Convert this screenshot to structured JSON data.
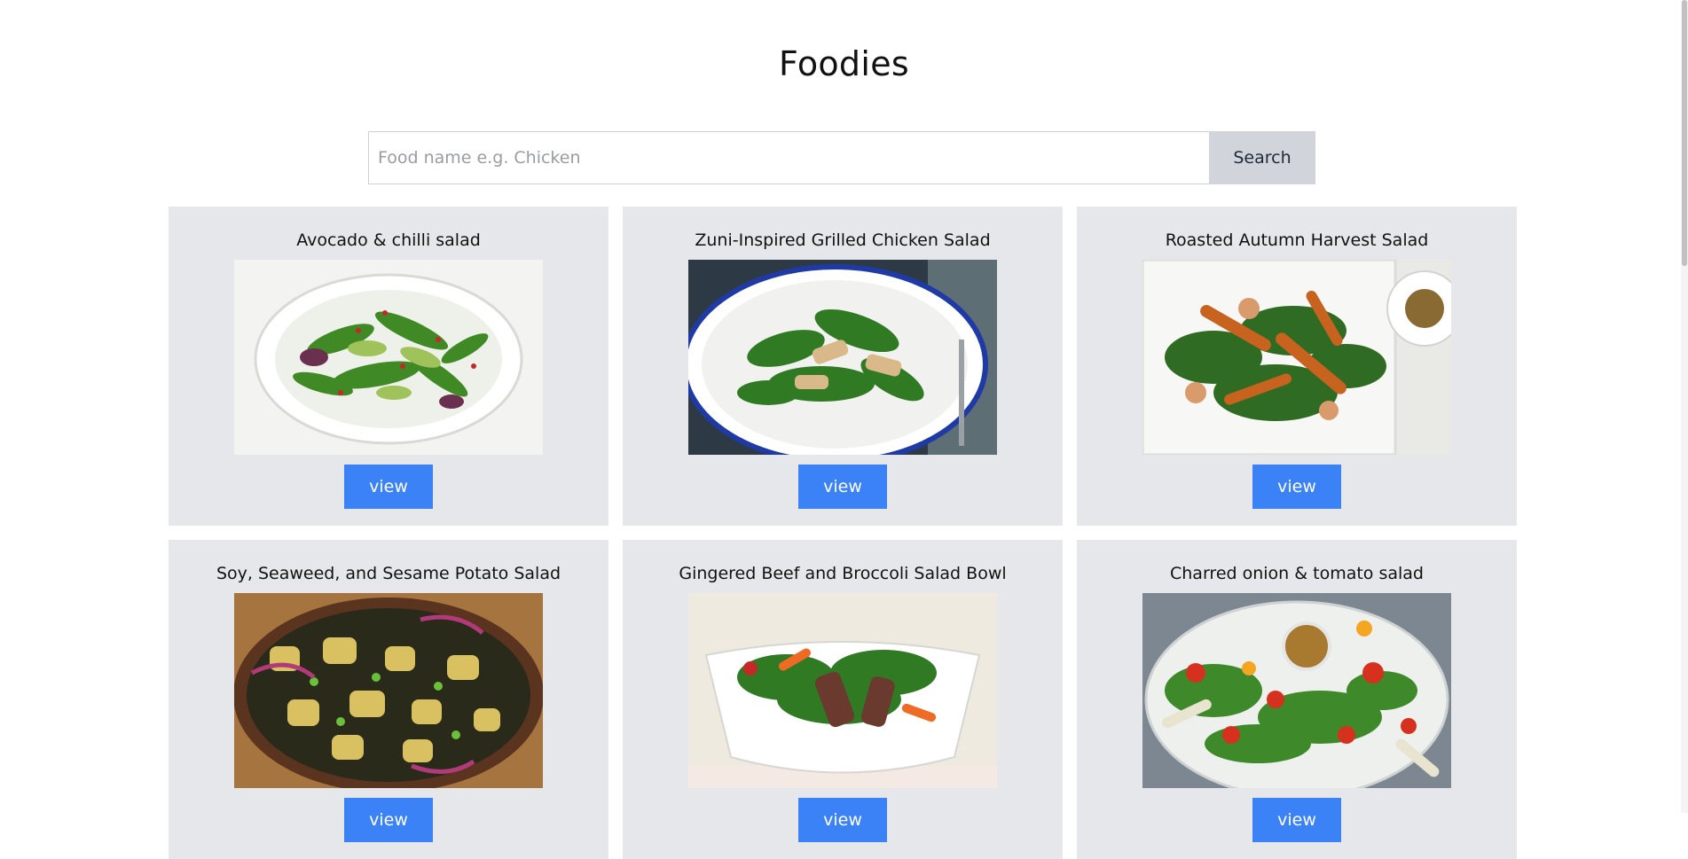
{
  "header": {
    "title": "Foodies"
  },
  "search": {
    "placeholder": "Food name e.g. Chicken",
    "value": "",
    "button_label": "Search"
  },
  "recipes": [
    {
      "title": "Avocado & chilli salad",
      "image_icon": "avocado-salad-photo",
      "button_label": "view"
    },
    {
      "title": "Zuni-Inspired Grilled Chicken Salad",
      "image_icon": "chicken-salad-photo",
      "button_label": "view"
    },
    {
      "title": "Roasted Autumn Harvest Salad",
      "image_icon": "harvest-salad-photo",
      "button_label": "view"
    },
    {
      "title": "Soy, Seaweed, and Sesame Potato Salad",
      "image_icon": "potato-salad-photo",
      "button_label": "view"
    },
    {
      "title": "Gingered Beef and Broccoli Salad Bowl",
      "image_icon": "beef-broccoli-photo",
      "button_label": "view"
    },
    {
      "title": "Charred onion & tomato salad",
      "image_icon": "onion-tomato-salad-photo",
      "button_label": "view"
    }
  ],
  "colors": {
    "card_bg": "#e5e7eb",
    "button_blue": "#3b82f6",
    "search_button_bg": "#d1d5db"
  }
}
